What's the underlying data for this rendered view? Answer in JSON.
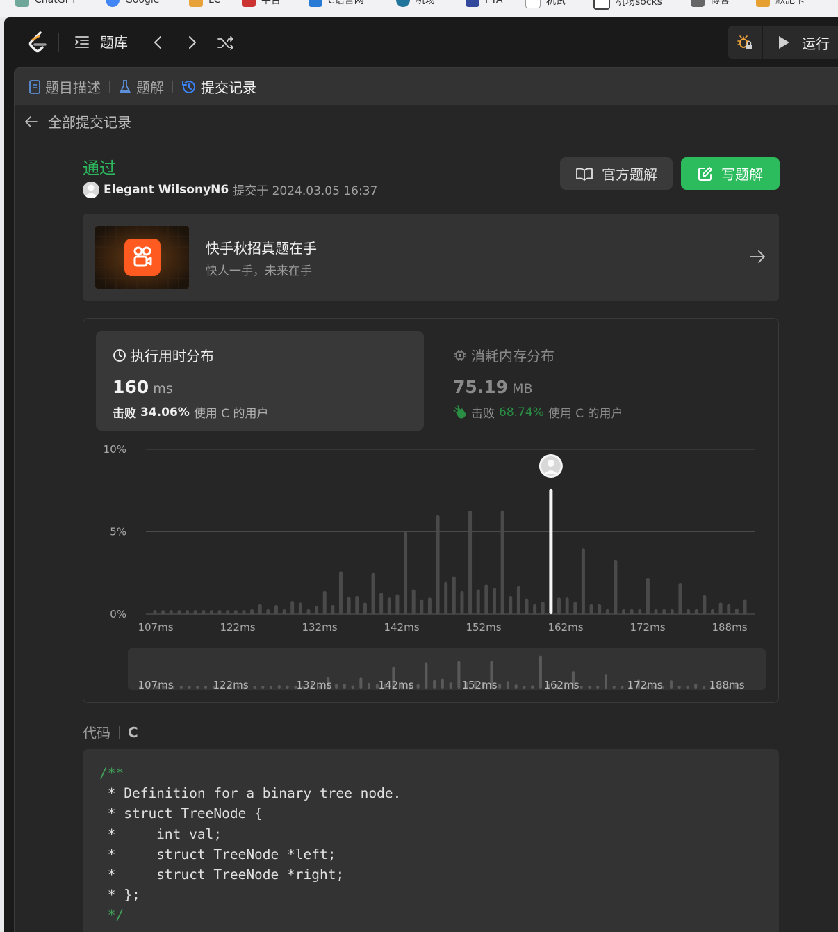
{
  "bookmarks": [
    "ChatGPT",
    "Google",
    "LC",
    "平台",
    "C语言网",
    "机场",
    "PTA",
    "机试",
    "机场socks",
    "博客",
    "默記卡"
  ],
  "topbar": {
    "problem_bank_label": "题库",
    "run_label": "运行"
  },
  "tabs": [
    {
      "label": "题目描述",
      "active": false
    },
    {
      "label": "题解",
      "active": false
    },
    {
      "label": "提交记录",
      "active": true
    }
  ],
  "back_label": "全部提交记录",
  "submission": {
    "status": "通过",
    "user": "Elegant WilsonyN6",
    "submitted_text": "提交于 2024.03.05 16:37",
    "official_solution_label": "官方题解",
    "write_solution_label": "写题解"
  },
  "promo": {
    "title": "快手秋招真题在手",
    "subtitle": "快人一手，未来在手"
  },
  "runtime": {
    "title": "执行用时分布",
    "value": "160",
    "unit": "ms",
    "beat_prefix": "击败",
    "beat_percent": "34.06%",
    "beat_suffix": "使用 C 的用户"
  },
  "memory": {
    "title": "消耗内存分布",
    "value": "75.19",
    "unit": "MB",
    "beat_prefix": "击败",
    "beat_percent": "68.74%",
    "beat_suffix": "使用 C 的用户"
  },
  "chart_data": {
    "type": "bar",
    "title": "执行用时分布",
    "yticks": [
      "10%",
      "5%",
      "0%"
    ],
    "ylim": [
      0,
      10
    ],
    "xticks": [
      "107ms",
      "122ms",
      "132ms",
      "142ms",
      "152ms",
      "162ms",
      "172ms",
      "188ms"
    ],
    "highlight_index": 49,
    "values": [
      0.25,
      0.25,
      0.25,
      0.25,
      0.25,
      0.25,
      0.25,
      0.25,
      0.25,
      0.25,
      0.25,
      0.25,
      0.3,
      0.6,
      0.3,
      0.55,
      0.3,
      0.8,
      0.7,
      0.3,
      0.5,
      1.4,
      0.55,
      2.6,
      1.05,
      1.1,
      0.7,
      2.5,
      1.3,
      1.0,
      1.2,
      5.0,
      1.5,
      0.9,
      1.0,
      6.0,
      1.95,
      2.3,
      1.4,
      6.3,
      1.5,
      1.8,
      1.6,
      6.3,
      1.1,
      1.7,
      0.95,
      0.6,
      0.75,
      7.6,
      1.0,
      1.0,
      0.75,
      4.0,
      0.6,
      0.6,
      0.3,
      3.3,
      0.3,
      0.3,
      0.3,
      2.2,
      0.3,
      0.3,
      0.3,
      1.9,
      0.3,
      0.3,
      1.15,
      0.3,
      0.7,
      0.6,
      0.35,
      0.9
    ],
    "colors": {
      "bar": "#4a4a4a",
      "highlight": "#f5f5f5"
    }
  },
  "code": {
    "label": "代码",
    "language": "C",
    "lines": [
      {
        "text": "/**",
        "comment_color": true
      },
      {
        "text": " * Definition for a binary tree node.",
        "comment_color": false
      },
      {
        "text": " * struct TreeNode {",
        "comment_color": false
      },
      {
        "text": " *     int val;",
        "comment_color": false
      },
      {
        "text": " *     struct TreeNode *left;",
        "comment_color": false
      },
      {
        "text": " *     struct TreeNode *right;",
        "comment_color": false
      },
      {
        "text": " * };",
        "comment_color": false
      },
      {
        "text": " */",
        "comment_color": true
      }
    ]
  }
}
